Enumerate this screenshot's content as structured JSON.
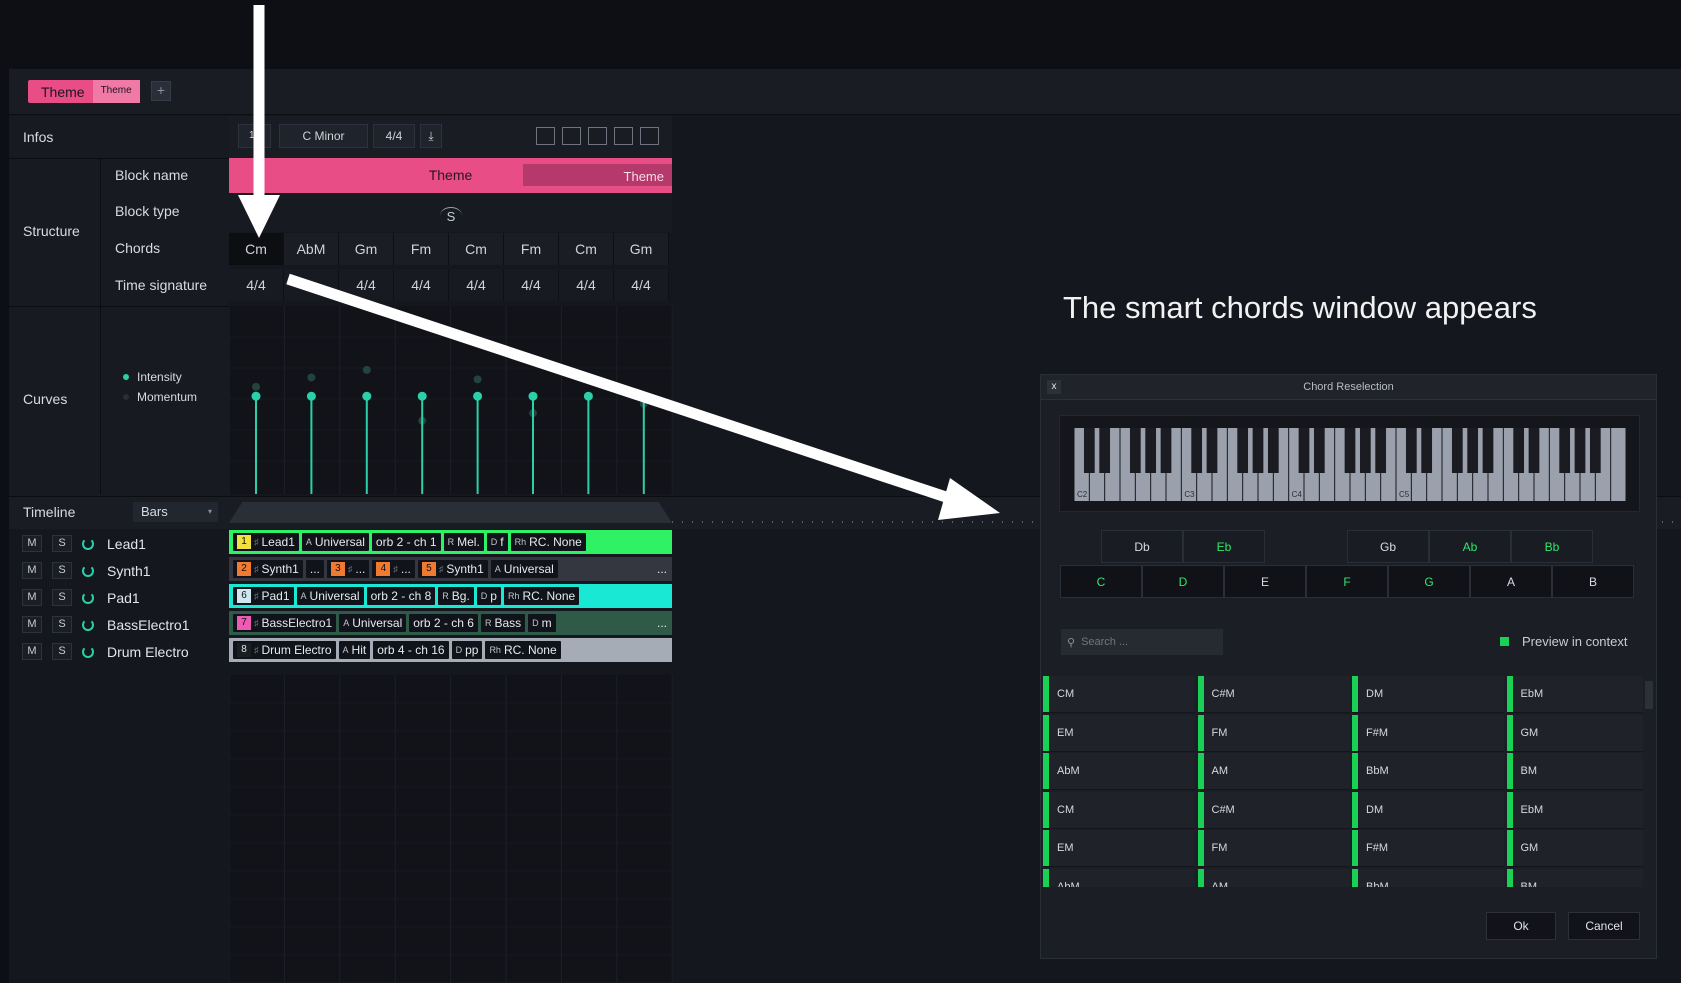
{
  "tab": {
    "name": "Theme",
    "badge": "Theme",
    "plus": "+"
  },
  "infos": {
    "label": "Infos",
    "tempo_fragment": "10",
    "key": "C Minor",
    "signature": "4/4",
    "download_glyph": "⤓"
  },
  "structure": {
    "label": "Structure",
    "block_name_label": "Block name",
    "block_name_value": "Theme",
    "block_name_badge": "Theme",
    "block_type_label": "Block type",
    "block_type_value": "S",
    "chords_label": "Chords",
    "chords": [
      "Cm",
      "AbM",
      "Gm",
      "Fm",
      "Cm",
      "Fm",
      "Cm",
      "Gm"
    ],
    "time_signature_label": "Time signature",
    "time_signatures": [
      "4/4",
      "",
      "4/4",
      "4/4",
      "4/4",
      "4/4",
      "4/4",
      "4/4"
    ]
  },
  "curves": {
    "label": "Curves",
    "legend": [
      "Intensity",
      "Momentum"
    ],
    "intensity": [
      0.52,
      0.52,
      0.52,
      0.52,
      0.52,
      0.52,
      0.52,
      0.52
    ],
    "momentum": [
      0.57,
      0.62,
      0.66,
      0.39,
      0.61,
      0.43,
      0.52,
      0.48
    ]
  },
  "timeline": {
    "label": "Timeline",
    "unit": "Bars"
  },
  "tracks": [
    {
      "mute": "M",
      "solo": "S",
      "name": "Lead1",
      "bar_color": "#2ef263",
      "chips": [
        {
          "n": "1",
          "nc": "#f0e040",
          "t": "Lead1"
        },
        {
          "k": "A",
          "t": "Universal"
        },
        {
          "t": "orb 2 - ch 1"
        },
        {
          "k": "R",
          "t": "Mel."
        },
        {
          "k": "D",
          "t": "f"
        },
        {
          "k": "Rh",
          "t": "RC. None"
        }
      ],
      "more": ""
    },
    {
      "mute": "M",
      "solo": "S",
      "name": "Synth1",
      "bar_color": "#34373f",
      "chips": [
        {
          "n": "2",
          "nc": "#f07a30",
          "t": "Synth1"
        },
        {
          "t": "..."
        },
        {
          "n": "3",
          "nc": "#f07a30",
          "t": "..."
        },
        {
          "n": "4",
          "nc": "#f07a30",
          "t": "..."
        },
        {
          "n": "5",
          "nc": "#f07a30",
          "t": "Synth1"
        },
        {
          "k": "A",
          "t": "Universal"
        }
      ],
      "more": "..."
    },
    {
      "mute": "M",
      "solo": "S",
      "name": "Pad1",
      "bar_color": "#19e8d4",
      "chips": [
        {
          "n": "6",
          "nc": "#cfe8f0",
          "t": "Pad1"
        },
        {
          "k": "A",
          "t": "Universal"
        },
        {
          "t": "orb 2 - ch 8"
        },
        {
          "k": "R",
          "t": "Bg."
        },
        {
          "k": "D",
          "t": "p"
        },
        {
          "k": "Rh",
          "t": "RC. None"
        }
      ],
      "more": ""
    },
    {
      "mute": "M",
      "solo": "S",
      "name": "BassElectro1",
      "bar_color": "#2e5a47",
      "chips": [
        {
          "n": "7",
          "nc": "#ee5ab4",
          "t": "BassElectro1"
        },
        {
          "k": "A",
          "t": "Universal"
        },
        {
          "t": "orb 2 - ch 6"
        },
        {
          "k": "R",
          "t": "Bass"
        },
        {
          "k": "D",
          "t": "m"
        }
      ],
      "more": "..."
    },
    {
      "mute": "M",
      "solo": "S",
      "name": "Drum Electro",
      "bar_color": "#a5acb5",
      "chips": [
        {
          "n": "8",
          "nc": "#1a1d22",
          "t": "Drum Electro"
        },
        {
          "k": "A",
          "t": "Hit"
        },
        {
          "t": "orb 4 - ch 16"
        },
        {
          "k": "D",
          "t": "pp"
        },
        {
          "k": "Rh",
          "t": "RC. None"
        }
      ],
      "more": ""
    }
  ],
  "annotation": "The smart chords window appears",
  "dialog": {
    "close": "x",
    "title": "Chord Reselection",
    "octave_labels": [
      "C2",
      "C3",
      "C4",
      "C5"
    ],
    "sharps": [
      {
        "label": "Db",
        "color": "#d8dbe2"
      },
      {
        "label": "Eb",
        "color": "#2ee86a"
      },
      {
        "label": "Gb",
        "color": "#d8dbe2"
      },
      {
        "label": "Ab",
        "color": "#2ee86a"
      },
      {
        "label": "Bb",
        "color": "#2ee86a"
      }
    ],
    "naturals": [
      {
        "label": "C",
        "color": "#2ee86a"
      },
      {
        "label": "D",
        "color": "#2ee86a"
      },
      {
        "label": "E",
        "color": "#d8dbe2"
      },
      {
        "label": "F",
        "color": "#2ee86a"
      },
      {
        "label": "G",
        "color": "#2ee86a"
      },
      {
        "label": "A",
        "color": "#d8dbe2"
      },
      {
        "label": "B",
        "color": "#d8dbe2"
      }
    ],
    "search_placeholder": "Search ...",
    "preview_label": "Preview in context",
    "chords": [
      [
        "CM",
        "C#M",
        "DM",
        "EbM"
      ],
      [
        "EM",
        "FM",
        "F#M",
        "GM"
      ],
      [
        "AbM",
        "AM",
        "BbM",
        "BM"
      ],
      [
        "CM",
        "C#M",
        "DM",
        "EbM"
      ],
      [
        "EM",
        "FM",
        "F#M",
        "GM"
      ],
      [
        "AbM",
        "AM",
        "BbM",
        "BM"
      ]
    ],
    "ok": "Ok",
    "cancel": "Cancel"
  }
}
